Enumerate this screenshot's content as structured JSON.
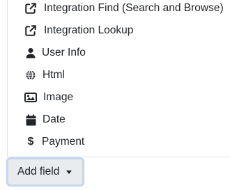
{
  "menu": {
    "items": [
      {
        "label": "Integration Find (Search and Browse)",
        "icon": "external-link-icon"
      },
      {
        "label": "Integration Lookup",
        "icon": "external-link-icon"
      },
      {
        "label": "User Info",
        "icon": "user-icon"
      },
      {
        "label": "Html",
        "icon": "globe-icon"
      },
      {
        "label": "Image",
        "icon": "image-icon"
      },
      {
        "label": "Date",
        "icon": "calendar-icon"
      },
      {
        "label": "Payment",
        "icon": "dollar-icon"
      }
    ]
  },
  "add_field": {
    "label": "Add field"
  }
}
